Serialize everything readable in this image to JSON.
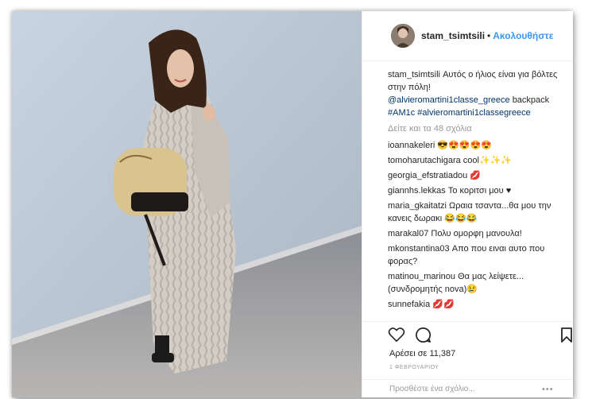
{
  "post": {
    "username": "stam_tsimtsili",
    "follow_label": "Ακολουθήστε",
    "separator": "•"
  },
  "caption": {
    "username": "stam_tsimtsili",
    "text": "Αυτός ο ήλιος είναι για βόλτες στην πόλη!",
    "mention": "@alvieromartini1classe_greece",
    "after_mention": "backpack",
    "hashtags": "#AM1c #alvieromartini1classegreece"
  },
  "view_all_comments": "Δείτε και τα 48 σχόλια",
  "comments": [
    {
      "user": "ioannakeleri",
      "text": "😎😍😍😍😍"
    },
    {
      "user": "tomoharutachigara",
      "text": "cool✨✨✨"
    },
    {
      "user": "georgia_efstratiadou",
      "text": "💋"
    },
    {
      "user": "giannhs.lekkas",
      "text": "Το κοριτσι μου ♥"
    },
    {
      "user": "maria_gkaitatzi",
      "text": "Ωραια τσαντα...θα μου την κανεις δωρακι 😂😂😂"
    },
    {
      "user": "marakal07",
      "text": "Πολυ ομορφη μανουλα!"
    },
    {
      "user": "mkonstantina03",
      "text": "Απο που ειναι αυτο που φορας?"
    },
    {
      "user": "matinou_marinou",
      "text": "Θα μας λείψετε...(συνδρομητής nova)😢"
    },
    {
      "user": "sunnefakia",
      "text": "💋💋"
    }
  ],
  "likes_text": "Αρέσει σε 11,387",
  "date_text": "1 ΦΕΒΡΟΥΑΡΙΟΥ",
  "add_comment_placeholder": "Προσθέστε ένα σχόλιο...",
  "more_options": "•••",
  "icons": {
    "like": "heart-outline",
    "comment": "speech-bubble",
    "save": "bookmark-outline"
  },
  "colors": {
    "link": "#3897f0",
    "mention": "#003569",
    "muted": "#999999"
  }
}
